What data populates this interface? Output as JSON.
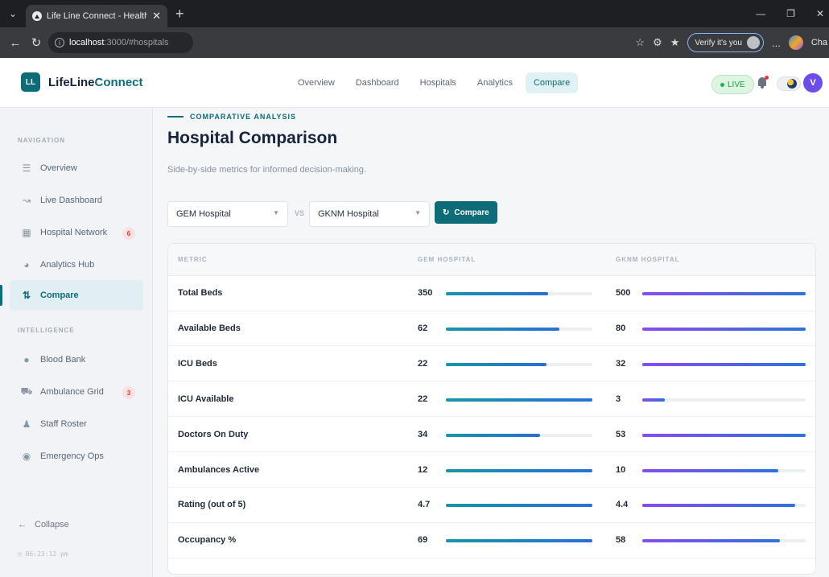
{
  "browser": {
    "tab_title": "Life Line Connect - Healthcare Inte",
    "url_host": "localhost",
    "url_path": ":3000/#hospitals",
    "verify_label": "Verify it's you",
    "more_label": "...",
    "extra_label": "Cha"
  },
  "header": {
    "logo": "LL",
    "brand_main": "LifeLine",
    "brand_accent": "Connect",
    "nav": [
      "Overview",
      "Dashboard",
      "Hospitals",
      "Analytics",
      "Compare"
    ],
    "live_label": "LIVE",
    "avatar_initial": "V"
  },
  "sidebar": {
    "navigation_label": "NAVIGATION",
    "intelligence_label": "INTELLIGENCE",
    "items": [
      {
        "label": "Overview"
      },
      {
        "label": "Live Dashboard"
      },
      {
        "label": "Hospital Network",
        "badge": "6"
      },
      {
        "label": "Analytics Hub"
      },
      {
        "label": "Compare"
      }
    ],
    "intel_items": [
      {
        "label": "Blood Bank"
      },
      {
        "label": "Ambulance Grid",
        "badge": "3"
      },
      {
        "label": "Staff Roster"
      },
      {
        "label": "Emergency Ops"
      }
    ],
    "collapse_label": "Collapse",
    "clock": "06:23:12 pm"
  },
  "main": {
    "eyebrow": "COMPARATIVE ANALYSIS",
    "title": "Hospital Comparison",
    "subtitle": "Side-by-side metrics for informed decision-making.",
    "hospital_a": "GEM Hospital",
    "hospital_b": "GKNM Hospital",
    "vs": "VS",
    "compare_button": "Compare",
    "col_metric": "METRIC",
    "col_a": "GEM HOSPITAL",
    "col_b": "GKNM HOSPITAL",
    "rows": [
      {
        "metric": "Total Beds",
        "a": "350",
        "b": "500",
        "a_pct": 70,
        "b_pct": 100
      },
      {
        "metric": "Available Beds",
        "a": "62",
        "b": "80",
        "a_pct": 77.5,
        "b_pct": 100
      },
      {
        "metric": "ICU Beds",
        "a": "22",
        "b": "32",
        "a_pct": 68.75,
        "b_pct": 100
      },
      {
        "metric": "ICU Available",
        "a": "22",
        "b": "3",
        "a_pct": 100,
        "b_pct": 13.6
      },
      {
        "metric": "Doctors On Duty",
        "a": "34",
        "b": "53",
        "a_pct": 64.2,
        "b_pct": 100
      },
      {
        "metric": "Ambulances Active",
        "a": "12",
        "b": "10",
        "a_pct": 100,
        "b_pct": 83.3
      },
      {
        "metric": "Rating (out of 5)",
        "a": "4.7",
        "b": "4.4",
        "a_pct": 100,
        "b_pct": 93.6
      },
      {
        "metric": "Occupancy %",
        "a": "69",
        "b": "58",
        "a_pct": 100,
        "b_pct": 84.1
      }
    ]
  }
}
